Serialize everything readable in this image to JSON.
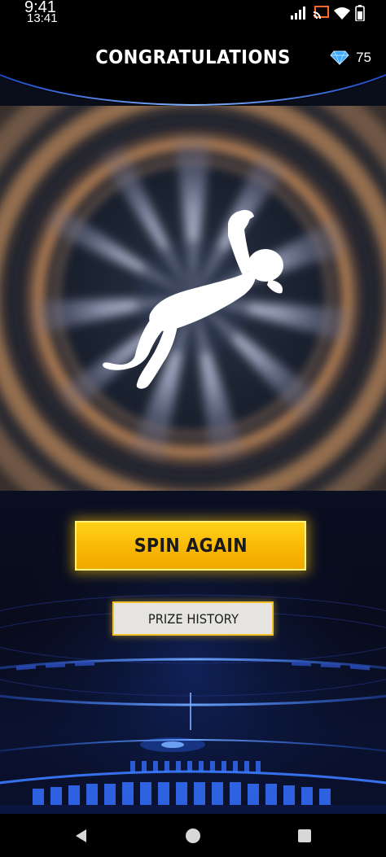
{
  "status_bar": {
    "time_primary": "9:41",
    "time_secondary": "13:41",
    "icons": [
      "signal-icon",
      "cast-icon",
      "wifi-icon",
      "battery-icon"
    ]
  },
  "header": {
    "title": "CONGRATULATIONS",
    "diamond_icon": "diamond-icon",
    "diamond_count": "75"
  },
  "reward": {
    "image": "reward-emote-silhouette"
  },
  "actions": {
    "spin_again_label": "SPIN AGAIN",
    "prize_history_label": "PRIZE HISTORY"
  },
  "nav_bar": {
    "icons": [
      "back-icon",
      "home-icon",
      "recents-icon"
    ]
  },
  "colors": {
    "accent_gold": "#f8b705",
    "accent_blue": "#2a74ff",
    "diamond": "#3aa8ff"
  }
}
